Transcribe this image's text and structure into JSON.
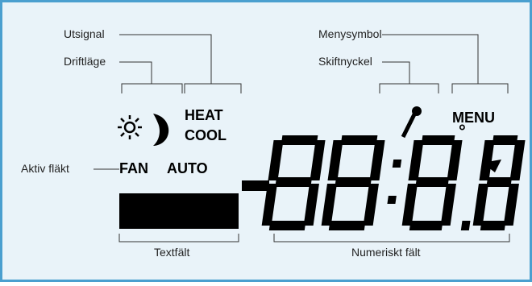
{
  "callouts": {
    "utsignal": "Utsignal",
    "driftlage": "Driftläge",
    "aktiv_flakt": "Aktiv fläkt",
    "menysymbol": "Menysymbol",
    "skiftnyckel": "Skiftnyckel",
    "textfalt": "Textfält",
    "numeriskt_falt": "Numeriskt fält"
  },
  "lcd": {
    "heat": "HEAT",
    "cool": "COOL",
    "fan": "FAN",
    "auto": "AUTO",
    "menu": "MENU",
    "degree": "°"
  },
  "icons": [
    "sun-icon",
    "moon-icon",
    "wrench-icon",
    "degree-symbol"
  ],
  "colors": {
    "background": "#e9f3f9",
    "border": "#4a9fcf",
    "lcd_ink": "#000000",
    "leader": "#333333"
  }
}
